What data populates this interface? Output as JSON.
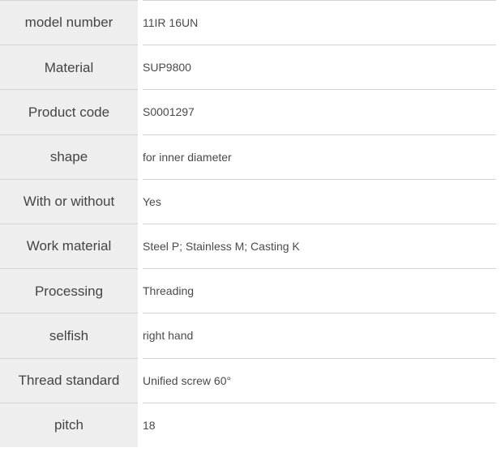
{
  "table": {
    "rows": [
      {
        "label": "model number",
        "value": "11IR 16UN"
      },
      {
        "label": "Material",
        "value": "SUP9800"
      },
      {
        "label": "Product code",
        "value": "S0001297"
      },
      {
        "label": "shape",
        "value": "for inner diameter"
      },
      {
        "label": "With or without",
        "value": "Yes"
      },
      {
        "label": "Work material",
        "value": "Steel P; Stainless M; Casting K"
      },
      {
        "label": "Processing",
        "value": "Threading"
      },
      {
        "label": "selfish",
        "value": "right hand"
      },
      {
        "label": "Thread standard",
        "value": "Unified screw 60°"
      },
      {
        "label": "pitch",
        "value": "18"
      }
    ]
  },
  "colors": {
    "label_background": "#eeeeee",
    "value_background": "#ffffff",
    "border": "#d3d3d3",
    "label_text": "#444444",
    "value_text": "#4a4a4a"
  }
}
